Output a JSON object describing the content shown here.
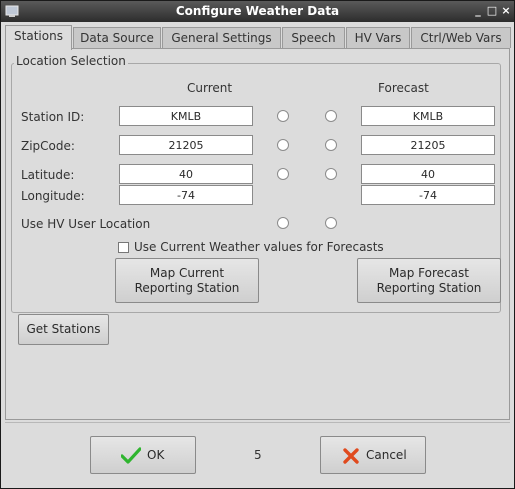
{
  "window": {
    "title": "Configure Weather Data",
    "controls": {
      "minimize": "_",
      "maximize": "□",
      "close": "×"
    }
  },
  "tabs": [
    {
      "label": "Stations",
      "active": true
    },
    {
      "label": "Data Source",
      "active": false
    },
    {
      "label": "General Settings",
      "active": false
    },
    {
      "label": "Speech",
      "active": false
    },
    {
      "label": "HV Vars",
      "active": false
    },
    {
      "label": "Ctrl/Web Vars",
      "active": false
    }
  ],
  "location": {
    "group_title": "Location Selection",
    "current_header": "Current",
    "forecast_header": "Forecast",
    "rows": [
      {
        "label": "Station ID:",
        "current": "KMLB",
        "forecast": "KMLB"
      },
      {
        "label": "ZipCode:",
        "current": "21205",
        "forecast": "21205"
      },
      {
        "label": "Latitude:",
        "current": "40",
        "forecast": "40"
      },
      {
        "label": "Longitude:",
        "current": "-74",
        "forecast": "-74"
      }
    ],
    "use_hv_label": "Use HV User Location",
    "use_current_checkbox_label": "Use Current Weather values for Forecasts",
    "use_current_checked": false,
    "map_current_button": [
      "Map Current",
      "Reporting Station"
    ],
    "map_forecast_button": [
      "Map Forecast",
      "Reporting Station"
    ]
  },
  "get_stations_button": "Get Stations",
  "footer": {
    "ok_label": "OK",
    "countdown": "5",
    "cancel_label": "Cancel"
  },
  "colors": {
    "titlebar": "#3a3a3a",
    "window_bg": "#dcdcdc",
    "ok_check": "#2fb52f",
    "cancel_x": "#e04a1e"
  }
}
